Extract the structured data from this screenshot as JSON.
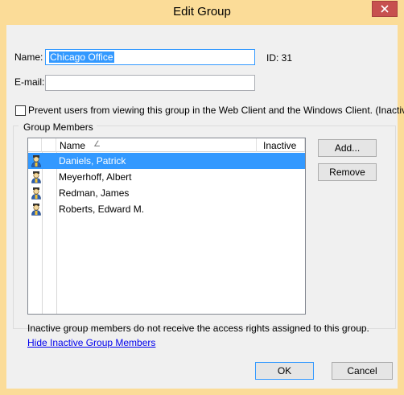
{
  "window": {
    "title": "Edit Group",
    "close_icon": "close-icon"
  },
  "form": {
    "name_label": "Name:",
    "name_value": "Chicago Office",
    "id_text": "ID: 31",
    "email_label": "E-mail:",
    "email_value": "",
    "prevent_label": "Prevent users from viewing this group in the Web Client and the Windows Client. (Inactive)",
    "prevent_checked": false
  },
  "members": {
    "group_title": "Group Members",
    "columns": {
      "name": "Name",
      "inactive": "Inactive"
    },
    "sort_icon": "sort-ascending-icon",
    "user_icon": "user-icon",
    "rows": [
      {
        "name": "Daniels, Patrick",
        "selected": true
      },
      {
        "name": "Meyerhoff, Albert",
        "selected": false
      },
      {
        "name": "Redman, James",
        "selected": false
      },
      {
        "name": "Roberts, Edward M.",
        "selected": false
      }
    ],
    "add_label": "Add...",
    "remove_label": "Remove",
    "note": "Inactive group members do not receive the access rights assigned to this group.",
    "hide_link": "Hide Inactive Group Members"
  },
  "footer": {
    "ok_label": "OK",
    "cancel_label": "Cancel"
  },
  "colors": {
    "frame": "#fbdc98",
    "close": "#c7504f",
    "selection": "#3399ff",
    "link": "#0000ee"
  }
}
